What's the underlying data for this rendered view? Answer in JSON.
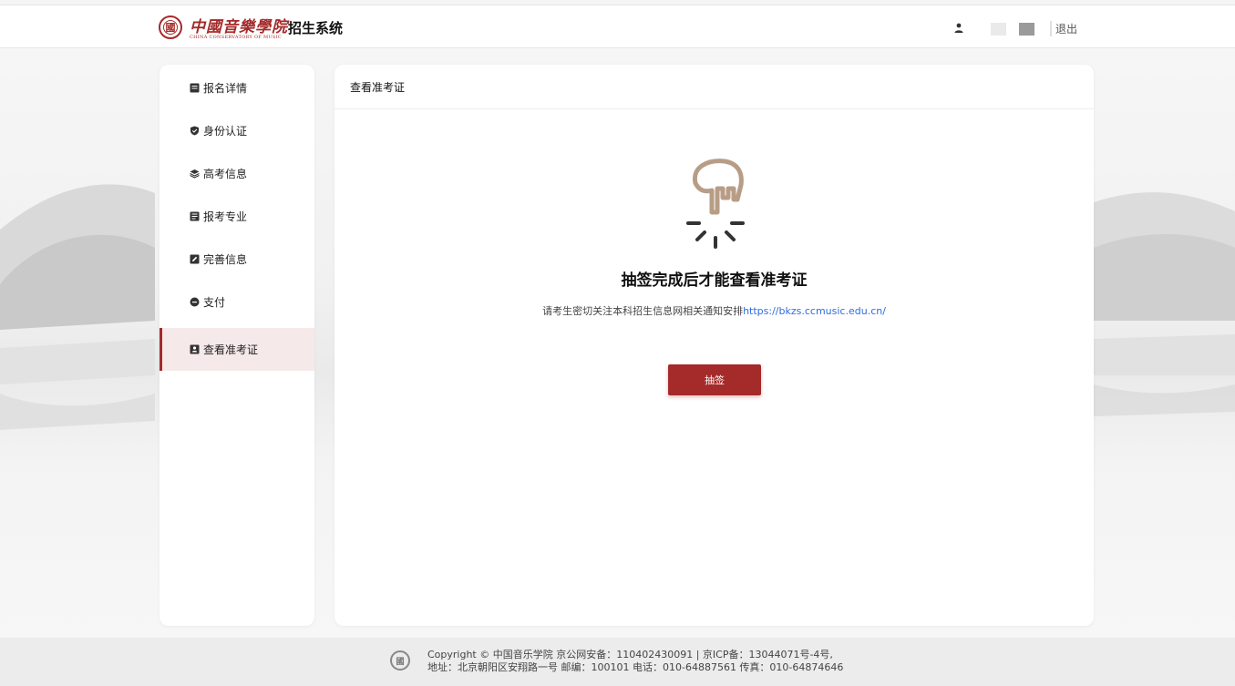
{
  "header": {
    "logo_seal": "國",
    "logo_name": "中國音樂學院",
    "logo_sub": "CHINA CONSERVATORY OF MUSIC",
    "system_name": "招生系统",
    "logout_label": "退出",
    "user_icon": "user-icon"
  },
  "sidebar": {
    "items": [
      {
        "label": "报名详情",
        "icon": "list-icon"
      },
      {
        "label": "身份认证",
        "icon": "shield-icon"
      },
      {
        "label": "高考信息",
        "icon": "layers-icon"
      },
      {
        "label": "报考专业",
        "icon": "document-icon"
      },
      {
        "label": "完善信息",
        "icon": "edit-icon"
      },
      {
        "label": "支付",
        "icon": "coin-icon"
      },
      {
        "label": "查看准考证",
        "icon": "id-card-icon",
        "active": true
      }
    ]
  },
  "main": {
    "heading": "查看准考证",
    "illustration": "pointing-hand-icon",
    "title": "抽签完成后才能查看准考证",
    "note_prefix": "请考生密切关注本科招生信息网相关通知安排",
    "note_link": "https://bkzs.ccmusic.edu.cn/",
    "button_label": "抽签"
  },
  "footer": {
    "line1": "Copyright © 中国音乐学院 京公网安备：110402430091 | 京ICP备：13044071号-4号,",
    "line2": "地址：北京朝阳区安翔路一号 邮编：100101 电话：010-64887561 传真：010-64874646"
  },
  "colors": {
    "brand": "#a52a2a",
    "link": "#2d6cdf",
    "active_bg": "#f6e9e9"
  }
}
